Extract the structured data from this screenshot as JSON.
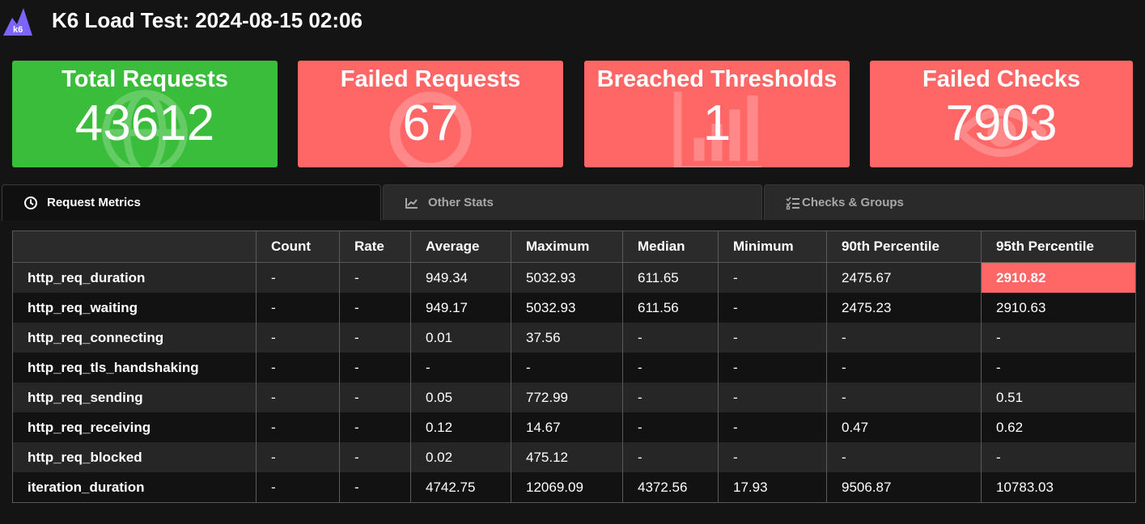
{
  "header": {
    "title": "K6 Load Test: 2024-08-15 02:06",
    "logo_text": "k6",
    "logo_icon": "k6-logo-icon"
  },
  "cards": [
    {
      "label": "Total Requests",
      "value": "43612",
      "color": "#3abd3a",
      "icon": "globe-icon"
    },
    {
      "label": "Failed Requests",
      "value": "67",
      "color": "#ff6666",
      "icon": "circle-icon"
    },
    {
      "label": "Breached Thresholds",
      "value": "1",
      "color": "#ff6666",
      "icon": "bar-chart-icon"
    },
    {
      "label": "Failed Checks",
      "value": "7903",
      "color": "#ff6666",
      "icon": "eye-icon"
    }
  ],
  "tabs": [
    {
      "label": "Request Metrics",
      "icon": "clock-icon",
      "active": true
    },
    {
      "label": "Other Stats",
      "icon": "line-chart-icon",
      "active": false
    },
    {
      "label": "Checks & Groups",
      "icon": "checklist-icon",
      "active": false
    }
  ],
  "table": {
    "headers": [
      "",
      "Count",
      "Rate",
      "Average",
      "Maximum",
      "Median",
      "Minimum",
      "90th Percentile",
      "95th Percentile"
    ],
    "rows": [
      [
        "http_req_duration",
        "-",
        "-",
        "949.34",
        "5032.93",
        "611.65",
        "-",
        "2475.67",
        "2910.82"
      ],
      [
        "http_req_waiting",
        "-",
        "-",
        "949.17",
        "5032.93",
        "611.56",
        "-",
        "2475.23",
        "2910.63"
      ],
      [
        "http_req_connecting",
        "-",
        "-",
        "0.01",
        "37.56",
        "-",
        "-",
        "-",
        "-"
      ],
      [
        "http_req_tls_handshaking",
        "-",
        "-",
        "-",
        "-",
        "-",
        "-",
        "-",
        "-"
      ],
      [
        "http_req_sending",
        "-",
        "-",
        "0.05",
        "772.99",
        "-",
        "-",
        "-",
        "0.51"
      ],
      [
        "http_req_receiving",
        "-",
        "-",
        "0.12",
        "14.67",
        "-",
        "-",
        "0.47",
        "0.62"
      ],
      [
        "http_req_blocked",
        "-",
        "-",
        "0.02",
        "475.12",
        "-",
        "-",
        "-",
        "-"
      ],
      [
        "iteration_duration",
        "-",
        "-",
        "4742.75",
        "12069.09",
        "4372.56",
        "17.93",
        "9506.87",
        "10783.03"
      ]
    ],
    "breached_color": "#ff6666"
  }
}
